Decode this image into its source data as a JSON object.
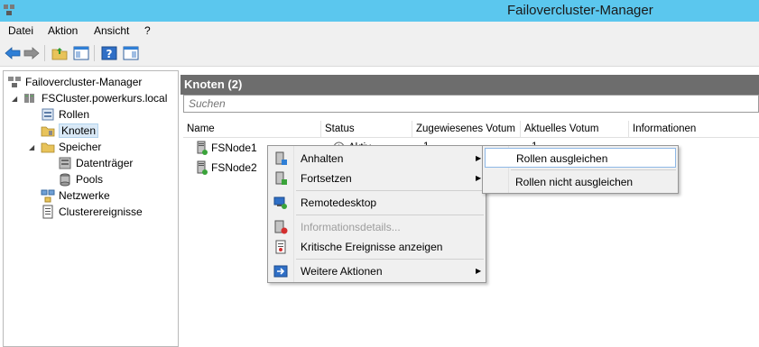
{
  "window": {
    "title": "Failovercluster-Manager"
  },
  "menu": {
    "items": [
      "Datei",
      "Aktion",
      "Ansicht",
      "?"
    ]
  },
  "tree": {
    "root": "Failovercluster-Manager",
    "cluster": "FSCluster.powerkurs.local",
    "items": {
      "roles": "Rollen",
      "nodes": "Knoten",
      "storage": "Speicher",
      "disks": "Datenträger",
      "pools": "Pools",
      "networks": "Netzwerke",
      "events": "Clusterereignisse"
    }
  },
  "main": {
    "header": "Knoten (2)",
    "search_placeholder": "Suchen",
    "columns": [
      "Name",
      "Status",
      "Zugewiesenes Votum",
      "Aktuelles Votum",
      "Informationen"
    ],
    "rows": [
      {
        "name": "FSNode1",
        "status": "Aktiv",
        "assigned_vote": "1",
        "current_vote": "1",
        "info": ""
      },
      {
        "name": "FSNode2",
        "status": "",
        "assigned_vote": "",
        "current_vote": "",
        "info": ""
      }
    ]
  },
  "context_menu": {
    "items": {
      "pause": "Anhalten",
      "resume": "Fortsetzen",
      "remote": "Remotedesktop",
      "details": "Informationsdetails...",
      "critical": "Kritische Ereignisse anzeigen",
      "more": "Weitere Aktionen"
    }
  },
  "submenu": {
    "items": {
      "drain": "Rollen ausgleichen",
      "no_drain": "Rollen nicht ausgleichen"
    }
  },
  "colors": {
    "titlebar": "#5bc7ee",
    "header": "#6d6d6d",
    "highlight_border": "#8eb8e6"
  }
}
